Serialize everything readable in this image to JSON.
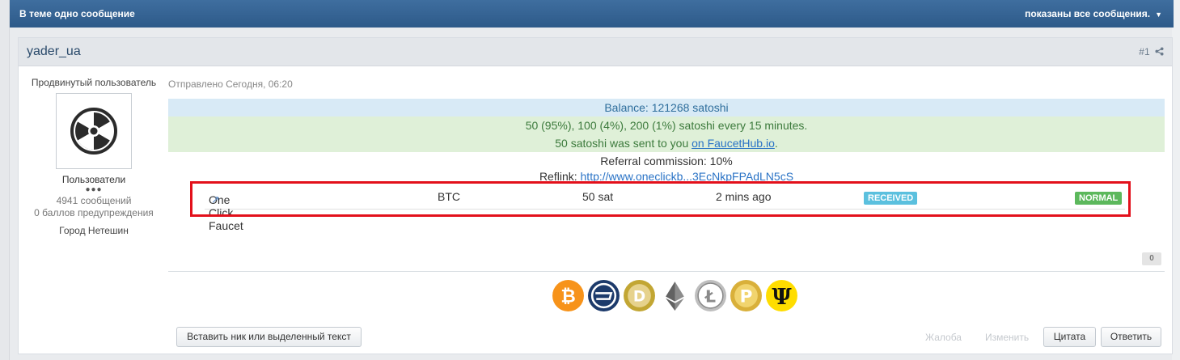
{
  "topic_bar": {
    "title": "В теме одно сообщение",
    "filter_label": "показаны все сообщения."
  },
  "post": {
    "author": "yader_ua",
    "number": "#1",
    "sent": "Отправлено Сегодня, 06:20",
    "user": {
      "rank": "Продвинутый пользователь",
      "group": "Пользователи",
      "dots": "●●●",
      "messages": "4941 сообщений",
      "warnings": "0 баллов предупреждения",
      "city": "Город Нетешин"
    },
    "content": {
      "balance": "Balance: 121268 satoshi",
      "rates": "50 (95%), 100 (4%), 200 (1%) satoshi every 15 minutes.",
      "sent_prefix": "50 satoshi was sent to you ",
      "sent_link": "on FaucetHub.io",
      "sent_suffix": ".",
      "referral": "Referral commission: 10%",
      "reflink_label": "Reflink: ",
      "reflink_url": "http://www.oneclickb...3EcNkpFPAdLN5cS"
    },
    "claim": {
      "faucet": "One Click Faucet",
      "currency": "BTC",
      "amount": "50 sat",
      "time": "2 mins ago",
      "status": "RECEIVED",
      "type": "NORMAL"
    },
    "reputation": "0",
    "coins": [
      "bitcoin-icon",
      "dash-icon",
      "dogecoin-icon",
      "ethereum-icon",
      "litecoin-icon",
      "peercoin-icon",
      "primecoin-icon"
    ],
    "actions": {
      "insert_nick": "Вставить ник или выделенный текст",
      "complaint": "Жалоба",
      "edit": "Изменить",
      "quote": "Цитата",
      "reply": "Ответить"
    }
  },
  "colors": {
    "topbar": "#2d5a89",
    "balance_bg": "#d8eaf6",
    "rates_bg": "#dff0d8",
    "received_badge": "#5bc0de",
    "normal_badge": "#5cb85c",
    "highlight_border": "#e3101b"
  }
}
